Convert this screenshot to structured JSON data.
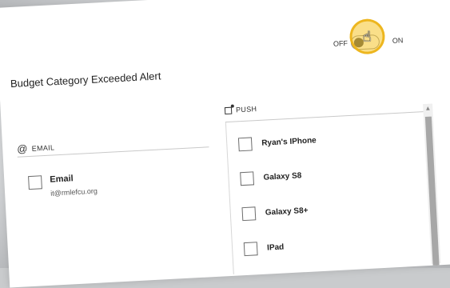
{
  "alert": {
    "title": "Budget Category Exceeded Alert",
    "toggle": {
      "off_label": "OFF",
      "on_label": "ON",
      "state": "off"
    }
  },
  "email": {
    "header": "EMAIL",
    "icon": "at-sign-icon",
    "items": [
      {
        "label": "Email",
        "address": "it@rmlefcu.org",
        "checked": false
      }
    ]
  },
  "push": {
    "header": "PUSH",
    "icon": "push-notification-icon",
    "devices": [
      {
        "label": "Ryan's IPhone",
        "checked": false
      },
      {
        "label": "Galaxy S8",
        "checked": false
      },
      {
        "label": "Galaxy S8+",
        "checked": false
      },
      {
        "label": "IPad",
        "checked": false
      }
    ]
  },
  "highlight_color": "#f3c12a",
  "scrollbar": {
    "icon": "scroll-up-arrow-icon"
  }
}
